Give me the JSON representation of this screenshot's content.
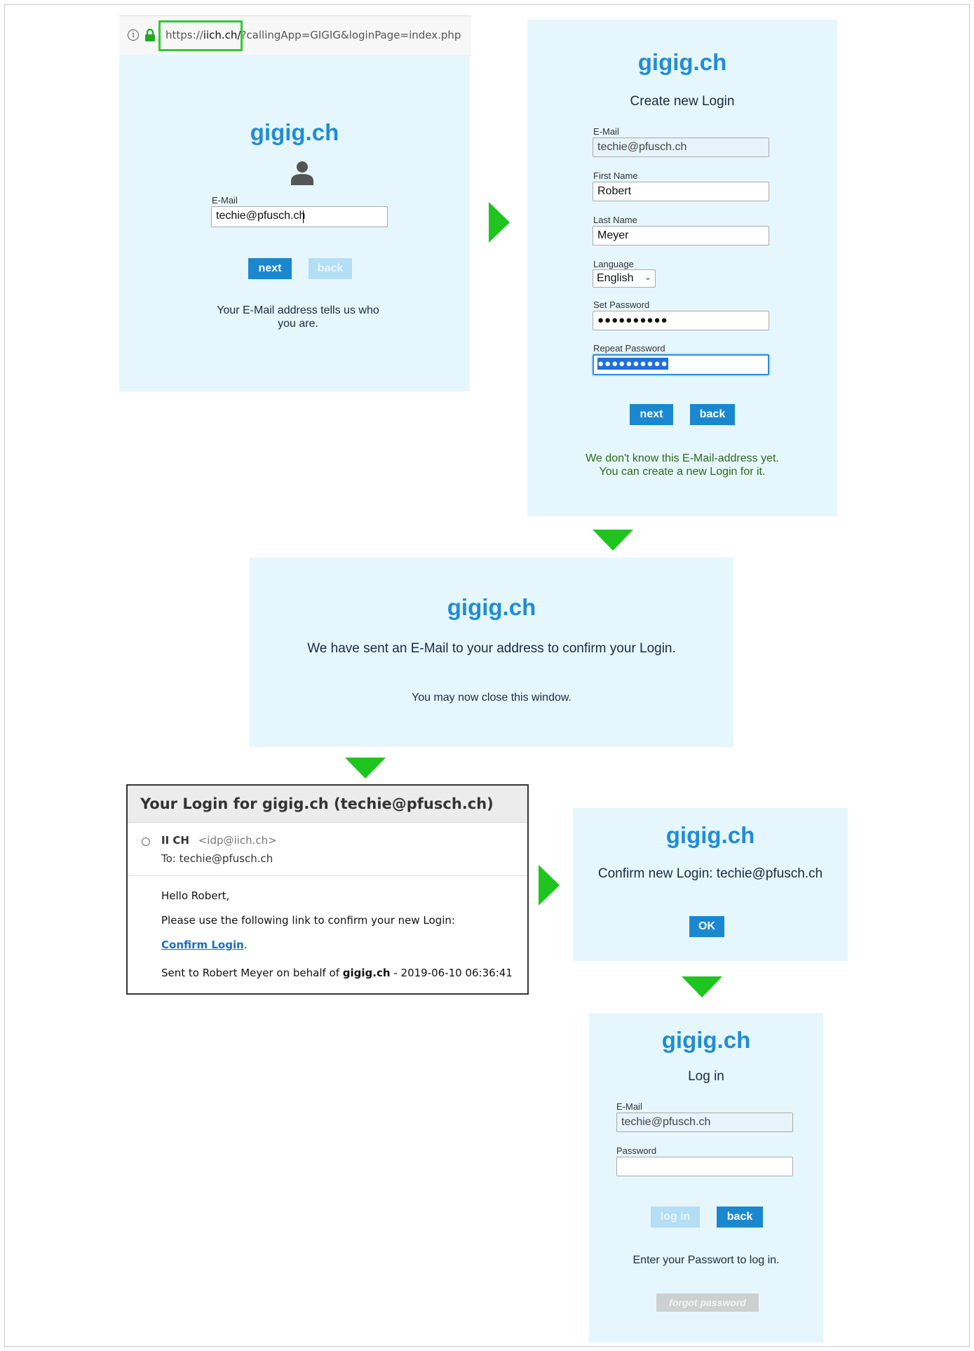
{
  "browser": {
    "url_prefix": "https://",
    "url_domain": "iich.ch/",
    "url_rest": "?callingApp=GIGIG&loginPage=index.php"
  },
  "step1": {
    "brand": "gigig.ch",
    "email_label": "E-Mail",
    "email_value": "techie@pfusch.ch",
    "next_label": "next",
    "back_label": "back",
    "message": "Your E-Mail address tells us who you are."
  },
  "step2": {
    "brand": "gigig.ch",
    "title": "Create new Login",
    "email_label": "E-Mail",
    "email_value": "techie@pfusch.ch",
    "first_name_label": "First Name",
    "first_name_value": "Robert",
    "last_name_label": "Last Name",
    "last_name_value": "Meyer",
    "language_label": "Language",
    "language_value": "English",
    "set_password_label": "Set Password",
    "set_password_value": "●●●●●●●●●●",
    "repeat_password_label": "Repeat Password",
    "repeat_password_value": "●●●●●●●●●●",
    "next_label": "next",
    "back_label": "back",
    "message_line1": "We don't know this E-Mail-address yet.",
    "message_line2": "You can create a new Login for it.",
    "message_color": "#2e6b14"
  },
  "step3": {
    "brand": "gigig.ch",
    "message": "We have sent an E-Mail to your address to confirm your Login.",
    "sub_message": "You may now close this window."
  },
  "email": {
    "subject": "Your Login for gigig.ch (techie@pfusch.ch)",
    "sender_name": "II CH",
    "sender_address": "<idp@iich.ch>",
    "to": "To: techie@pfusch.ch",
    "greeting": "Hello Robert,",
    "instruction": "Please use the following link to confirm your new Login:",
    "link_text": "Confirm Login",
    "link_suffix": ".",
    "footer_prefix": "Sent to Robert Meyer on behalf of",
    "footer_brand": "gigig.ch",
    "footer_suffix": " - 2019-06-10 06:36:41"
  },
  "step4": {
    "brand": "gigig.ch",
    "message": "Confirm new Login: techie@pfusch.ch",
    "ok_label": "OK"
  },
  "step5": {
    "brand": "gigig.ch",
    "title": "Log in",
    "email_label": "E-Mail",
    "email_value": "techie@pfusch.ch",
    "password_label": "Password",
    "password_value": "",
    "login_label": "log in",
    "back_label": "back",
    "message": "Enter your Passwort to log in.",
    "forgot_label": "forgot password"
  },
  "colors": {
    "arrow": "#1fc41f",
    "panel": "#e6f6fd",
    "brand": "#1f8dd6",
    "button": "#1a88d0",
    "highlight": "#2fcc2f"
  }
}
